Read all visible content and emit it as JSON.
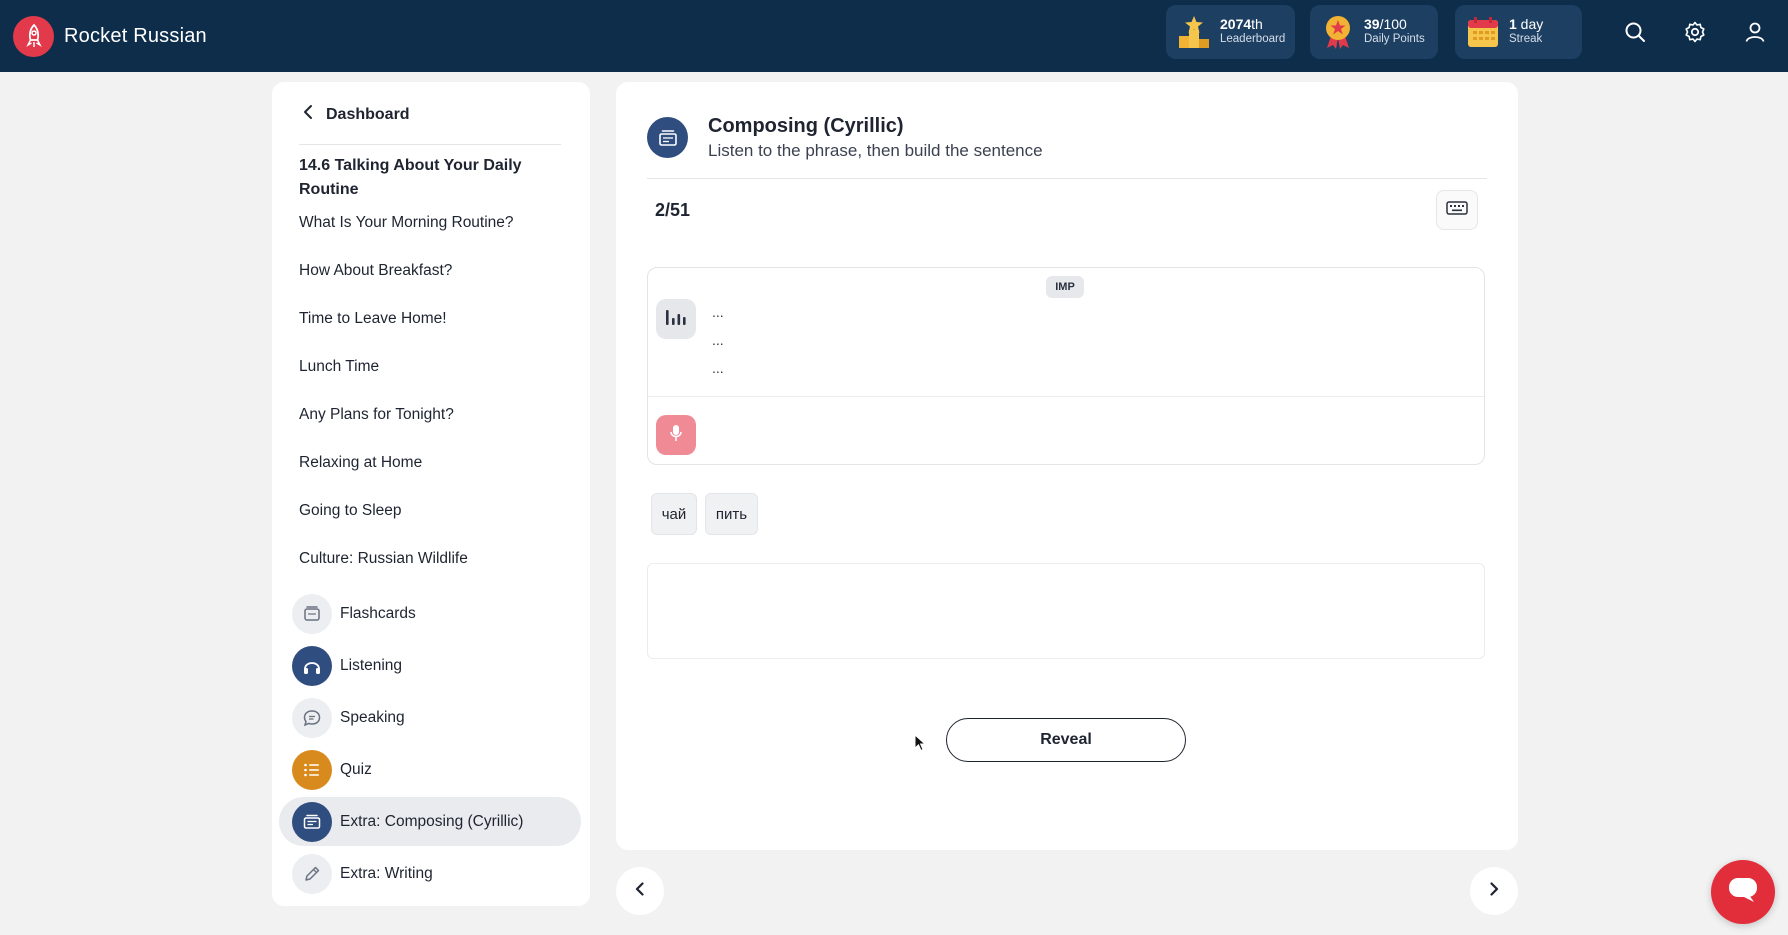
{
  "app": {
    "name": "Rocket Russian"
  },
  "stats": {
    "leaderboard": {
      "rank": "2074",
      "suffix": "th",
      "label": "Leaderboard"
    },
    "daily_points": {
      "value": "39",
      "max": "/100",
      "label": "Daily Points"
    },
    "streak": {
      "value": "1",
      "unit": " day",
      "label": "Streak"
    }
  },
  "colors": {
    "header": "#0e2d4b",
    "brand_red": "#e23a4a",
    "accent_navy": "#2f4d7e",
    "quiz_orange": "#d98a1c"
  },
  "sidebar": {
    "back_label": "Dashboard",
    "lesson_title": "14.6 Talking About Your Daily Routine",
    "links": [
      "What Is Your Morning Routine?",
      "How About Breakfast?",
      "Time to Leave Home!",
      "Lunch Time",
      "Any Plans for Tonight?",
      "Relaxing at Home",
      "Going to Sleep",
      "Culture: Russian Wildlife"
    ],
    "activities": [
      {
        "label": "Flashcards",
        "icon": "flashcards-icon"
      },
      {
        "label": "Listening",
        "icon": "headphones-icon"
      },
      {
        "label": "Speaking",
        "icon": "speech-bubble-icon"
      },
      {
        "label": "Quiz",
        "icon": "list-icon"
      },
      {
        "label": "Extra: Composing (Cyrillic)",
        "icon": "composing-icon",
        "active": true
      },
      {
        "label": "Extra: Writing",
        "icon": "pencil-icon"
      }
    ]
  },
  "exercise": {
    "title": "Composing (Cyrillic)",
    "subtitle": "Listen to the phrase, then build the sentence",
    "progress": "2/51",
    "badge": "IMP",
    "phrase_lines": [
      "...",
      "...",
      "..."
    ],
    "word_chips": [
      "чай",
      "пить"
    ],
    "reveal_label": "Reveal"
  }
}
